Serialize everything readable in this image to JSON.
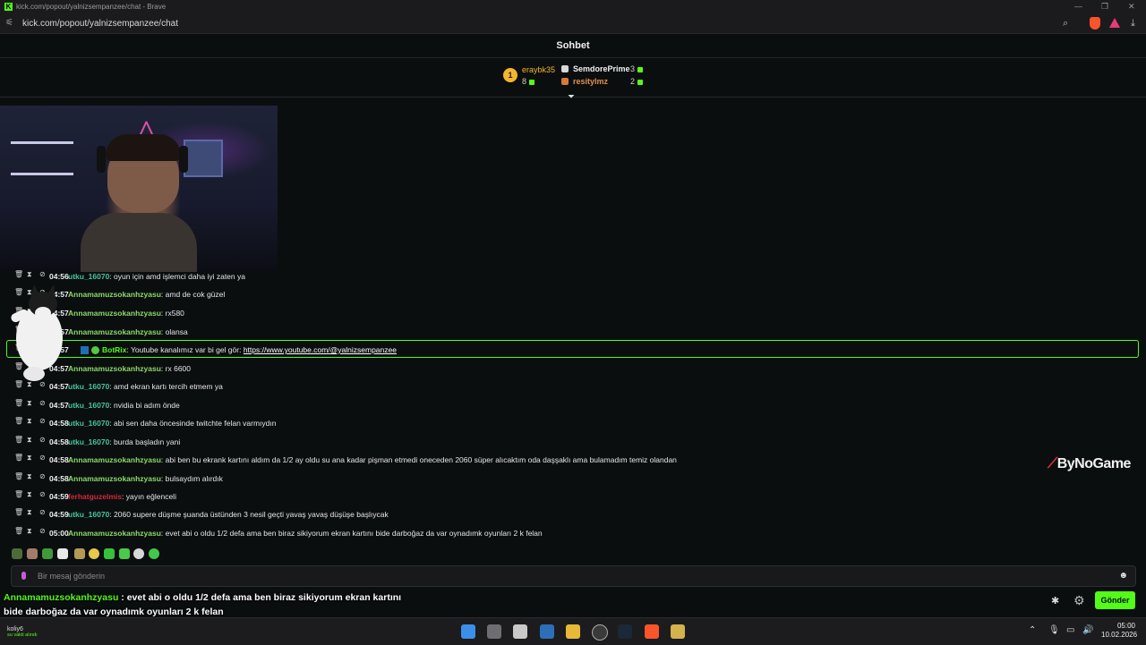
{
  "browser": {
    "title": "kick.com/popout/yalnizsempanzee/chat - Brave",
    "url": "kick.com/popout/yalnizsempanzee/chat"
  },
  "chat": {
    "title": "Sohbet",
    "leaderboard": {
      "first": {
        "rank": "1",
        "name": "eraybk35",
        "count": "8"
      },
      "second": {
        "name": "SemdorePrime",
        "count": "3"
      },
      "third": {
        "name": "resitylmz",
        "count": "2"
      }
    },
    "messages": [
      {
        "time": "04:56",
        "user": "utku_16070",
        "text": ": oyun için amd işlemci daha iyi zaten ya",
        "color": "#47c4a0"
      },
      {
        "time": "04:57",
        "user": "Annamamuzsokanhzyasu",
        "text": ": amd de cok güzel",
        "color": "#8bd96a"
      },
      {
        "time": "04:57",
        "user": "Annamamuzsokanhzyasu",
        "text": ": rx580",
        "color": "#8bd96a"
      },
      {
        "time": "04:57",
        "user": "Annamamuzsokanhzyasu",
        "text": ": olansa",
        "color": "#8bd96a"
      },
      {
        "time": "04:57",
        "user": "BotRix",
        "text": ": Youtube kanalımız var bi gel gör: ",
        "link": "https://www.youtube.com/@yalnizsempanzee",
        "color": "#53fc18"
      },
      {
        "time": "04:57",
        "user": "Annamamuzsokanhzyasu",
        "text": ": rx 6600",
        "color": "#8bd96a"
      },
      {
        "time": "04:57",
        "user": "utku_16070",
        "text": ": amd ekran kartı tercih etmem ya",
        "color": "#47c4a0"
      },
      {
        "time": "04:57",
        "user": "utku_16070",
        "text": ": nvidia bi adım önde",
        "color": "#47c4a0"
      },
      {
        "time": "04:58",
        "user": "utku_16070",
        "text": ": abi sen daha öncesinde twitchte felan varmıydın",
        "color": "#47c4a0"
      },
      {
        "time": "04:58",
        "user": "utku_16070",
        "text": ": burda başladın yani",
        "color": "#47c4a0"
      },
      {
        "time": "04:58",
        "user": "Annamamuzsokanhzyasu",
        "text": ": abi ben bu ekrank kartını aldım da 1/2 ay oldu su ana kadar pişman etmedi oneceden 2060 süper alıcaktım oda daşşaklı ama bulamadım temiz olandan",
        "color": "#8bd96a"
      },
      {
        "time": "04:58",
        "user": "Annamamuzsokanhzyasu",
        "text": ": bulsaydım alırdık",
        "color": "#8bd96a"
      },
      {
        "time": "04:59",
        "user": "ferhatguzelmis",
        "text": ": yayın eğlenceli",
        "color": "#d32a3a"
      },
      {
        "time": "04:59",
        "user": "utku_16070",
        "text": ": 2060 supere düşme şuanda üstünden 3 nesil geçti yavaş yavaş düşüşe başlıycak",
        "color": "#47c4a0"
      },
      {
        "time": "05:00",
        "user": "Annamamuzsokanhzyasu",
        "text": ": evet abi o oldu 1/2 defa ama ben biraz sikiyorum ekran kartını bide darboğaz da var oynadımk oyunları 2 k felan",
        "color": "#8bd96a"
      }
    ],
    "input_placeholder": "Bir mesaj gönderin",
    "send_label": "Gönder"
  },
  "overlay": {
    "brand": "ByNoGame",
    "subtitle_user": "Annamamuzsokanhzyasu",
    "subtitle_line1": " : evet abi o oldu 1/2 defa ama ben biraz sikiyorum ekran kartını",
    "subtitle_line2": "bide darboğaz da var oynadımk oyunları 2 k felan"
  },
  "taskbar": {
    "user": "koliy6",
    "user_status": "su vakti alındı",
    "time": "05:00",
    "date": "10.02.2026"
  }
}
